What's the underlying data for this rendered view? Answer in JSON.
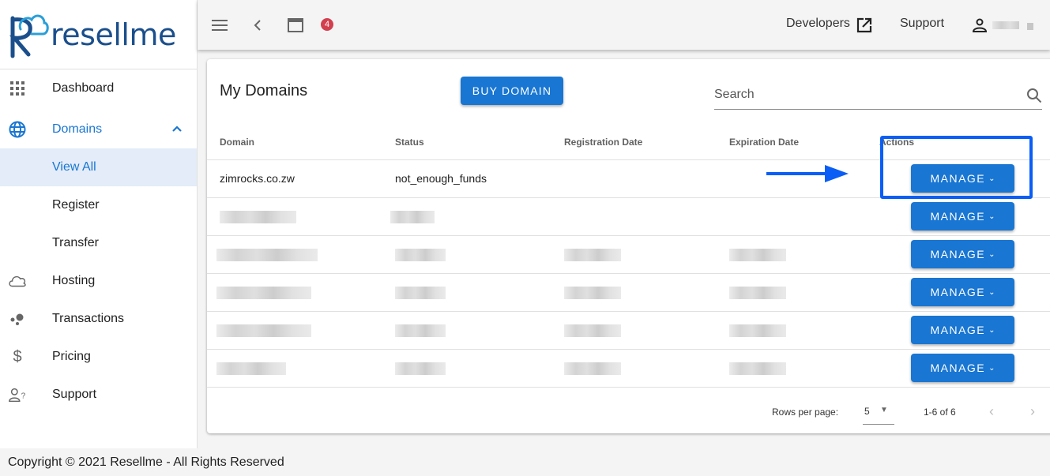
{
  "brand": {
    "name": "resellme",
    "primary_color": "#1976d2",
    "logo_color": "#1b4f8c"
  },
  "sidebar": {
    "items": [
      {
        "label": "Dashboard",
        "icon": "apps-grid-icon"
      },
      {
        "label": "Domains",
        "icon": "globe-icon",
        "expanded": true,
        "children": [
          {
            "label": "View All",
            "selected": true
          },
          {
            "label": "Register"
          },
          {
            "label": "Transfer"
          }
        ]
      },
      {
        "label": "Hosting",
        "icon": "cloud-icon"
      },
      {
        "label": "Transactions",
        "icon": "bubbles-icon"
      },
      {
        "label": "Pricing",
        "icon": "dollar-icon"
      },
      {
        "label": "Support",
        "icon": "person-question-icon"
      }
    ]
  },
  "topbar": {
    "notification_count": "4",
    "developers_label": "Developers",
    "support_label": "Support",
    "user_name": "[redacted]"
  },
  "main": {
    "title": "My Domains",
    "buy_button": "BUY DOMAIN",
    "search_placeholder": "Search",
    "table": {
      "columns": [
        "Domain",
        "Status",
        "Registration Date",
        "Expiration Date",
        "Actions"
      ],
      "rows": [
        {
          "domain": "zimrocks.co.zw",
          "status": "not_enough_funds",
          "registration_date": "",
          "expiration_date": "",
          "action": "MANAGE",
          "redacted": false
        },
        {
          "domain": "[redacted]",
          "status": "[redacted]",
          "registration_date": "",
          "expiration_date": "",
          "action": "MANAGE",
          "redacted": true
        },
        {
          "domain": "[redacted]",
          "status": "[redacted]",
          "registration_date": "[redacted]",
          "expiration_date": "[redacted]",
          "action": "MANAGE",
          "redacted": true
        },
        {
          "domain": "[redacted]",
          "status": "[redacted]",
          "registration_date": "[redacted]",
          "expiration_date": "[redacted]",
          "action": "MANAGE",
          "redacted": true
        },
        {
          "domain": "[redacted]",
          "status": "[redacted]",
          "registration_date": "[redacted]",
          "expiration_date": "[redacted]",
          "action": "MANAGE",
          "redacted": true
        },
        {
          "domain": "[redacted]",
          "status": "[redacted]",
          "registration_date": "[redacted]",
          "expiration_date": "[redacted]",
          "action": "MANAGE",
          "redacted": true
        }
      ]
    },
    "pagination": {
      "rows_per_page_label": "Rows per page:",
      "rows_per_page_value": "5",
      "range": "1-6 of 6"
    }
  },
  "annotation": {
    "highlight_color": "#0a5ef5",
    "target": "first-row-manage-button"
  },
  "footer": {
    "copyright": "Copyright © 2021 Resellme - All Rights Reserved"
  }
}
